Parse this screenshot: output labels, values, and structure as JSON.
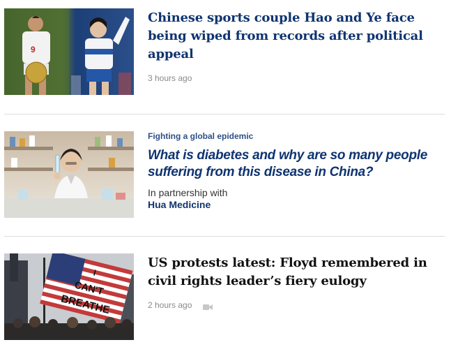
{
  "articles": [
    {
      "headline": "Chinese sports couple Hao and Ye face being wiped from records after political appeal",
      "timestamp": "3 hours ago",
      "thumbnail": "football-players-photo"
    },
    {
      "kicker": "Fighting a global epidemic",
      "headline": "What is diabetes and why are so many people suffering from this disease in China?",
      "partner_label": "In partnership with",
      "partner_name": "Hua Medicine",
      "thumbnail": "lab-scientist-photo"
    },
    {
      "headline": "US protests latest: Floyd remembered in civil rights leader’s fiery eulogy",
      "timestamp": "2 hours ago",
      "thumbnail": "protest-flag-photo",
      "flag_text": [
        "I",
        "CAN'T",
        "BREATHE"
      ],
      "has_video_icon": true
    }
  ],
  "colors": {
    "headline_blue": "#0f3470",
    "kicker_blue": "#2d4f89",
    "timestamp_gray": "#8a8a8a",
    "divider_gray": "#dddddd"
  }
}
